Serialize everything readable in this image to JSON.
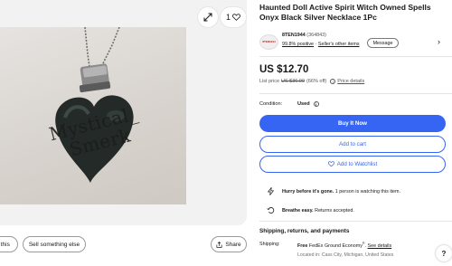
{
  "gallery": {
    "watermark_line1": "Mystical_",
    "watermark_line2": "Smerk",
    "watch_count": "1",
    "share_this_label": "re this",
    "sell_label": "Sell something else",
    "share_label": "Share"
  },
  "listing": {
    "title": "Haunted Doll Active Spirit Witch Owned Spells Onyx Black Silver Necklace 1Pc"
  },
  "seller": {
    "logo_text": "8TEN1944",
    "name": "8TEN1944",
    "score": "(364843)",
    "positive": "99.8% positive",
    "separator": "·",
    "other_items": "Seller's other items",
    "message_label": "Message",
    "chevron": "›"
  },
  "pricing": {
    "price": "US $12.70",
    "list_price_label": "List price",
    "list_price_value": "US $36.99",
    "discount": "(66% off)",
    "price_details": "Price details"
  },
  "condition": {
    "label": "Condition:",
    "value": "Used"
  },
  "actions": {
    "buy_now": "Buy It Now",
    "add_to_cart": "Add to cart",
    "add_to_watchlist": "Add to Watchlist"
  },
  "notices": {
    "hurry_bold": "Hurry before it's gone.",
    "hurry_text": "1 person is watching this item.",
    "breathe_bold": "Breathe easy.",
    "breathe_text": "Returns accepted."
  },
  "shipping": {
    "heading": "Shipping, returns, and payments",
    "label": "Shipping:",
    "free": "Free",
    "method": "FedEx Ground Economy",
    "superscript": "®",
    "details": "See details",
    "location": "Located in: Cass City, Michigan, United States"
  },
  "help": {
    "label": "?"
  },
  "colors": {
    "accent_blue": "#3665f3",
    "gallery_bg": "#f2f2f2",
    "text": "#191919"
  },
  "icons": [
    "expand-icon",
    "heart-icon",
    "share-icon",
    "info-icon",
    "watchlist-heart-icon",
    "lightning-icon",
    "returns-icon",
    "chevron-right-icon"
  ]
}
